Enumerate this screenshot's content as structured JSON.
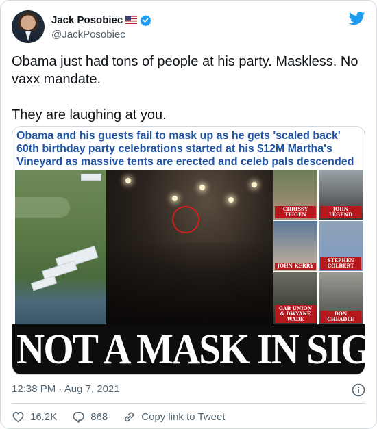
{
  "author": {
    "display_name": "Jack Posobiec",
    "handle": "@JackPosobiec",
    "flag_icon": "us-flag-icon",
    "verified_icon": "verified-badge-icon"
  },
  "tweet": {
    "text": "Obama just had tons of people at his party. Maskless. No vaxx mandate.\n\nThey are laughing at you."
  },
  "media": {
    "headline": "Obama and his guests fail to mask up as he gets 'scaled back' 60th birthday party celebrations started at his $12M Martha's Vineyard as massive tents are erected and celeb pals descended on island",
    "captions": [
      "CHRISSY TEIGEN",
      "JOHN LEGEND",
      "JOHN KERRY",
      "STEPHEN COLBERT",
      "GAB UNION & DWYANE WADE",
      "DON CHEADLE"
    ],
    "banner": "NOT A MASK IN SIGHT"
  },
  "meta": {
    "timestamp": "12:38 PM · Aug 7, 2021"
  },
  "actions": {
    "likes": "16.2K",
    "replies": "868",
    "copy_link": "Copy link to Tweet"
  },
  "colors": {
    "brand": "#1d9bf0",
    "headline": "#1f54a8",
    "caption_bg": "#b5191e",
    "muted": "#536471"
  }
}
